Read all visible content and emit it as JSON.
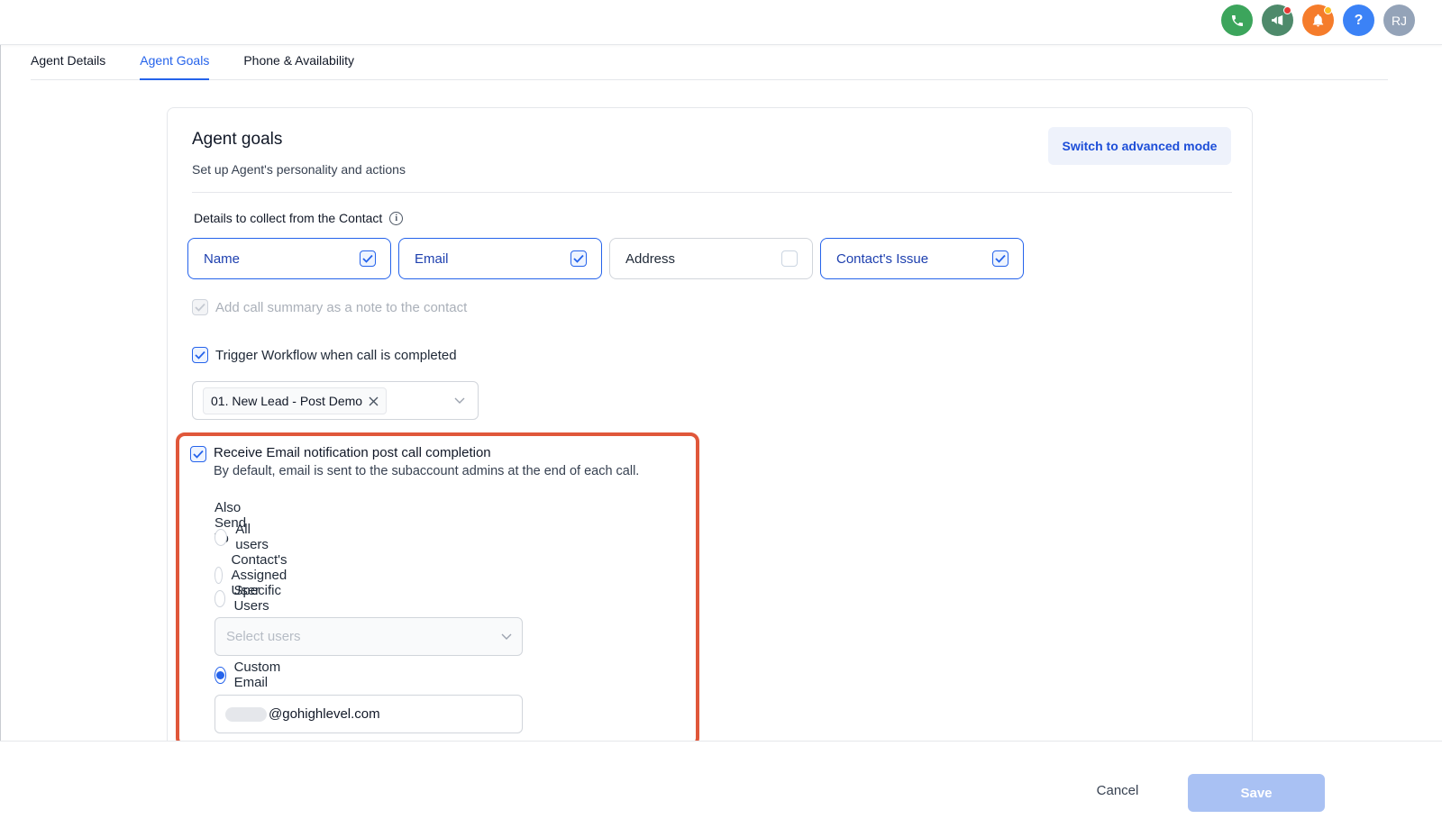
{
  "topbar": {
    "icons": [
      {
        "name": "phone-icon",
        "color": "#3ca55c"
      },
      {
        "name": "megaphone-icon",
        "color": "#4e8a6b",
        "badge": "#e53935"
      },
      {
        "name": "bell-icon",
        "color": "#f57c2b",
        "badge": "#fbbf24"
      },
      {
        "name": "help-icon",
        "color": "#3b82f6",
        "glyph": "?"
      },
      {
        "name": "avatar",
        "color": "#94a3b8",
        "initials": "RJ"
      }
    ]
  },
  "tabs": [
    {
      "label": "Agent Details",
      "active": false
    },
    {
      "label": "Agent Goals",
      "active": true
    },
    {
      "label": "Phone & Availability",
      "active": false
    }
  ],
  "card": {
    "title": "Agent goals",
    "subtitle": "Set up Agent's personality and actions",
    "advanced_button": "Switch to advanced mode",
    "collect_label": "Details to collect from the Contact",
    "fields": [
      {
        "label": "Name",
        "checked": true
      },
      {
        "label": "Email",
        "checked": true
      },
      {
        "label": "Address",
        "checked": false
      },
      {
        "label": "Contact's Issue",
        "checked": true
      }
    ],
    "call_summary_label": "Add call summary as a note to the contact",
    "trigger_workflow_label": "Trigger Workflow when call is completed",
    "workflow_tag": "01. New Lead - Post Demo",
    "email_notification": {
      "title": "Receive Email notification post call completion",
      "description": "By default, email is sent to the subaccount admins at the end of each call.",
      "also_send_to": "Also Send To",
      "options": [
        "All users",
        "Contact's Assigned User",
        "Specific Users"
      ],
      "select_users_placeholder": "Select users",
      "custom_email_label": "Custom Email",
      "custom_email_value": "@gohighlevel.com"
    }
  },
  "footer": {
    "cancel": "Cancel",
    "save": "Save"
  },
  "colors": {
    "accent": "#2563eb",
    "highlight": "#e0573a"
  }
}
